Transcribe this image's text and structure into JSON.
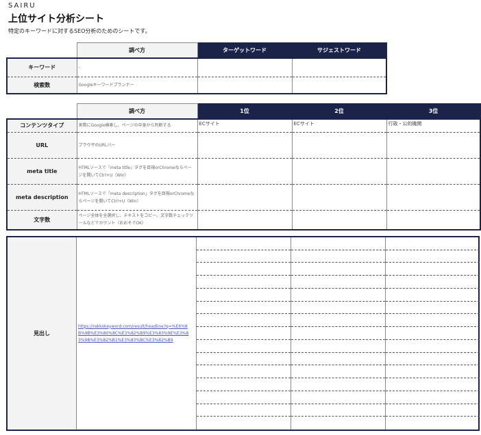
{
  "header": {
    "brand": "SAIRU",
    "title": "上位サイト分析シート",
    "subtitle": "特定のキーワードに対するSEO分析のためのシートです。"
  },
  "table1": {
    "col_headers": [
      "調べ方",
      "ターゲットワード",
      "サジェストワード"
    ],
    "rows": [
      {
        "label": "キーワード",
        "method": "-"
      },
      {
        "label": "検索数",
        "method": "Googleキーワードプランナー"
      }
    ]
  },
  "table2": {
    "col_headers": [
      "調べ方",
      "1位",
      "2位",
      "3位"
    ],
    "rows": [
      {
        "label": "コンテンツタイプ",
        "method": "実際にGoogle検索し、ページの中身から判断する",
        "r1": "ECサイト",
        "r2": "ECサイト",
        "r3": "行政・公的機関"
      },
      {
        "label": "URL",
        "method": "ブラウザのURLバー",
        "r1": "",
        "r2": "",
        "r3": ""
      },
      {
        "label": "meta title",
        "method": "HTMLソースで「meta title」タグを目視orChromeならページを開いてCtrl+U（Win）",
        "r1": "",
        "r2": "",
        "r3": ""
      },
      {
        "label": "meta description",
        "method": "HTMLソースで「meta description」タグを目視orChromeならページを開いてCtrl+U（Win）",
        "r1": "",
        "r2": "",
        "r3": ""
      },
      {
        "label": "文字数",
        "method": "ページ全体を全選択し、テキストをコピー。文字数チェックツールなどでカウント（おおそでOK）",
        "r1": "",
        "r2": "",
        "r3": ""
      }
    ]
  },
  "table3": {
    "label": "見出し",
    "link": "https://rakkokeyword.com/result/headline?q=%E6%8B%9B%E3%80%8C%E3%82%B9%E3%83%9E%E3%83%9B%E3%82%B1%E3%83%BC%E3%82%B9"
  }
}
